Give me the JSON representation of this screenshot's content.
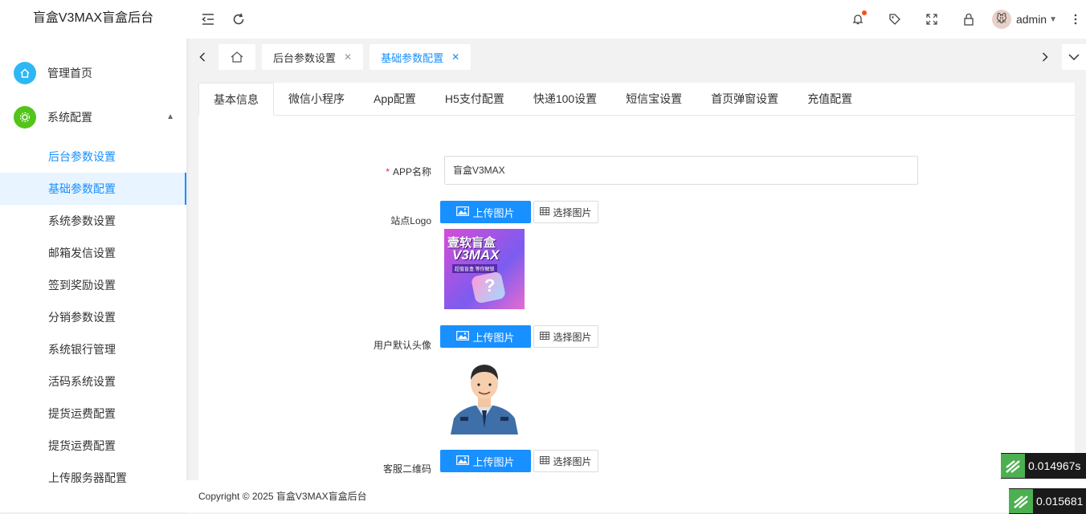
{
  "app": {
    "title": "盲盒V3MAX盲盒后台"
  },
  "sidebar": {
    "home": {
      "label": "管理首页"
    },
    "system": {
      "label": "系统配置"
    },
    "items": [
      {
        "label": "后台参数设置"
      },
      {
        "label": "基础参数配置"
      },
      {
        "label": "系统参数设置"
      },
      {
        "label": "邮箱发信设置"
      },
      {
        "label": "签到奖励设置"
      },
      {
        "label": "分销参数设置"
      },
      {
        "label": "系统银行管理"
      },
      {
        "label": "活码系统设置"
      },
      {
        "label": "提货运费配置"
      },
      {
        "label": "提货运费配置"
      },
      {
        "label": "上传服务器配置"
      }
    ]
  },
  "topbar": {
    "user": "admin"
  },
  "tabs": {
    "items": [
      {
        "label": "后台参数设置"
      },
      {
        "label": "基础参数配置"
      }
    ]
  },
  "panel": {
    "tabs": [
      {
        "label": "基本信息"
      },
      {
        "label": "微信小程序"
      },
      {
        "label": "App配置"
      },
      {
        "label": "H5支付配置"
      },
      {
        "label": "快递100设置"
      },
      {
        "label": "短信宝设置"
      },
      {
        "label": "首页弹窗设置"
      },
      {
        "label": "充值配置"
      }
    ]
  },
  "form": {
    "app_name_label": "APP名称",
    "app_name_value": "盲盒V3MAX",
    "logo_label": "站点Logo",
    "avatar_label": "用户默认头像",
    "qr_label": "客服二维码",
    "upload_label": "上传图片",
    "select_label": "选择图片",
    "logo_image": {
      "line1": "壹软盲盒",
      "line2": "V3MAX",
      "line3": "超值盲盒 等你解锁"
    }
  },
  "footer": {
    "text": "Copyright © 2025 盲盒V3MAX盲盒后台"
  },
  "timers": {
    "t1": "0.014967s",
    "t2": "0.015681"
  },
  "colors": {
    "accent": "#1890ff",
    "home_icon": "#2db7f5",
    "system_icon": "#52c41a",
    "upload_button": "#1890ff"
  }
}
